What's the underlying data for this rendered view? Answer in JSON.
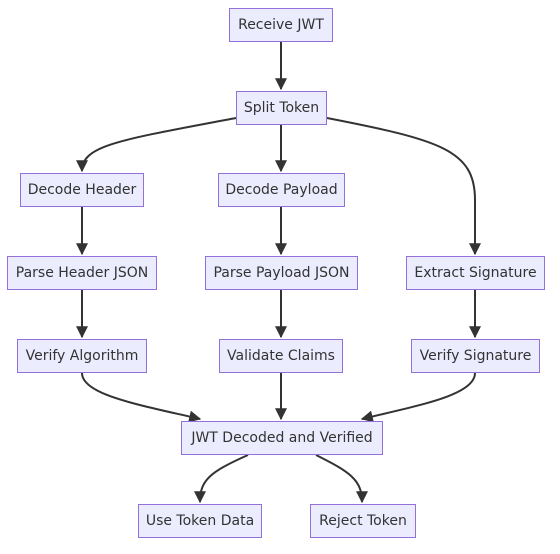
{
  "diagram": {
    "type": "flowchart",
    "direction": "top-down",
    "colors": {
      "node_fill": "#ECECFF",
      "node_stroke": "#9370DB",
      "edge": "#333333",
      "text": "#333333"
    },
    "nodes": [
      {
        "id": "receive",
        "label": "Receive JWT"
      },
      {
        "id": "split",
        "label": "Split Token"
      },
      {
        "id": "decodeHeader",
        "label": "Decode Header"
      },
      {
        "id": "decodePayload",
        "label": "Decode Payload"
      },
      {
        "id": "parseHeader",
        "label": "Parse Header JSON"
      },
      {
        "id": "parsePayload",
        "label": "Parse Payload JSON"
      },
      {
        "id": "extractSig",
        "label": "Extract Signature"
      },
      {
        "id": "verifyAlg",
        "label": "Verify Algorithm"
      },
      {
        "id": "validateClaims",
        "label": "Validate Claims"
      },
      {
        "id": "verifySig",
        "label": "Verify Signature"
      },
      {
        "id": "decoded",
        "label": "JWT Decoded and Verified"
      },
      {
        "id": "useData",
        "label": "Use Token Data"
      },
      {
        "id": "reject",
        "label": "Reject Token"
      }
    ],
    "edges": [
      {
        "from": "receive",
        "to": "split"
      },
      {
        "from": "split",
        "to": "decodeHeader"
      },
      {
        "from": "split",
        "to": "decodePayload"
      },
      {
        "from": "split",
        "to": "extractSig"
      },
      {
        "from": "decodeHeader",
        "to": "parseHeader"
      },
      {
        "from": "decodePayload",
        "to": "parsePayload"
      },
      {
        "from": "parseHeader",
        "to": "verifyAlg"
      },
      {
        "from": "parsePayload",
        "to": "validateClaims"
      },
      {
        "from": "extractSig",
        "to": "verifySig"
      },
      {
        "from": "verifyAlg",
        "to": "decoded"
      },
      {
        "from": "validateClaims",
        "to": "decoded"
      },
      {
        "from": "verifySig",
        "to": "decoded"
      },
      {
        "from": "decoded",
        "to": "useData"
      },
      {
        "from": "decoded",
        "to": "reject"
      }
    ]
  }
}
